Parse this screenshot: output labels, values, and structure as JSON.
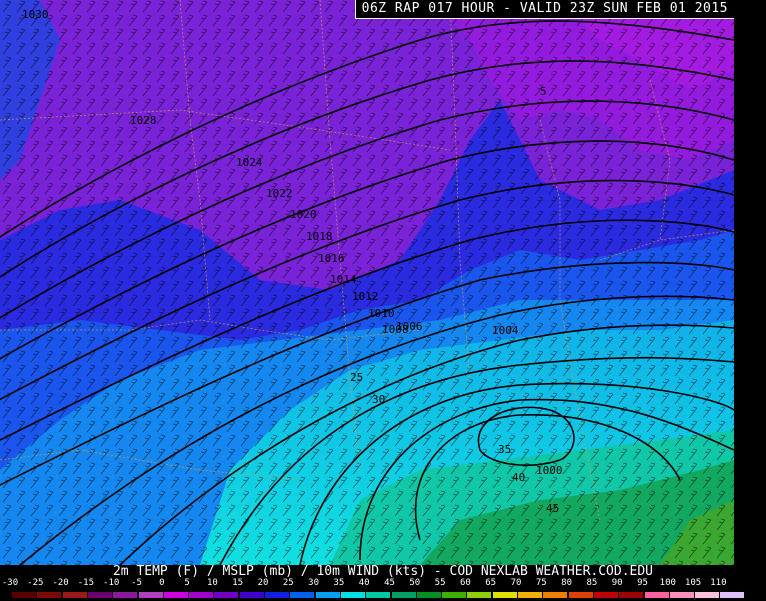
{
  "title": "06Z RAP 017 HOUR - VALID 23Z SUN FEB 01 2015",
  "caption": "2m TEMP (F) / MSLP (mb) / 10m WIND (kts) - COD NEXLAB  WEATHER.COD.EDU",
  "scale": {
    "labels": [
      "-30",
      "-25",
      "-20",
      "-15",
      "-10",
      "-5",
      "0",
      "5",
      "10",
      "15",
      "20",
      "25",
      "30",
      "35",
      "40",
      "45",
      "50",
      "55",
      "60",
      "65",
      "70",
      "75",
      "80",
      "85",
      "90",
      "95",
      "100",
      "105",
      "110"
    ],
    "colors": [
      "#5a0000",
      "#7a0a0a",
      "#9a1a1a",
      "#6a0070",
      "#8a1a9a",
      "#b040c0",
      "#d000e0",
      "#a000d0",
      "#7000c8",
      "#4000d0",
      "#1020e0",
      "#0060f0",
      "#00a0f0",
      "#00e0e0",
      "#00c8a0",
      "#00a060",
      "#009020",
      "#40b000",
      "#90d000",
      "#e0e000",
      "#f0b000",
      "#f08000",
      "#e04000",
      "#c00000",
      "#a00000",
      "#ff60a0",
      "#ff90c0",
      "#ffc0e0",
      "#e0c0ff"
    ]
  },
  "isobar_labels": [
    "1030",
    "1028",
    "1024",
    "1022",
    "1020",
    "1018",
    "1016",
    "1014",
    "1012",
    "1010",
    "1008",
    "1006",
    "1004",
    "1000"
  ],
  "temp_labels": [
    "5",
    "25",
    "30",
    "35",
    "40",
    "45"
  ],
  "colors": {
    "frame_background": "#000000",
    "text": "#ffffff",
    "very_cold_purple": "#7a1ed6",
    "cold_blue": "#1e32e6",
    "cool_blue": "#1a6af2",
    "mild_cyan": "#10d8e6",
    "green": "#18b06a",
    "magenta": "#d000e0"
  }
}
